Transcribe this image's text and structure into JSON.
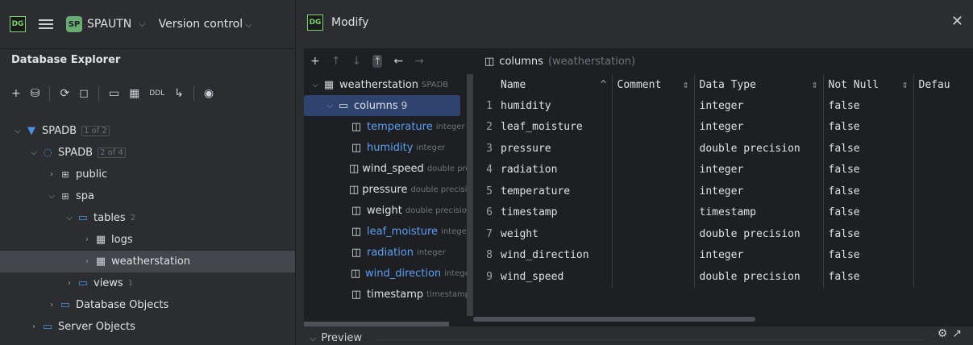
{
  "appbar": {
    "logo": "DG",
    "project_badge": "SP",
    "project_name": "SPAUTN",
    "version_control": "Version control"
  },
  "explorer": {
    "title": "Database Explorer",
    "toolbar": {
      "ddl": "DDL"
    },
    "tree": [
      {
        "label": "SPADB",
        "count": "1 of 2"
      },
      {
        "label": "SPADB",
        "count": "2 of 4"
      },
      {
        "label": "public"
      },
      {
        "label": "spa"
      },
      {
        "label": "tables",
        "count": "2"
      },
      {
        "label": "logs"
      },
      {
        "label": "weatherstation"
      },
      {
        "label": "views",
        "count": "1"
      },
      {
        "label": "Database Objects"
      },
      {
        "label": "Server Objects"
      }
    ]
  },
  "dialog": {
    "title": "Modify",
    "logo": "DG",
    "tree_root": {
      "label": "weatherstation",
      "type": "SPADB"
    },
    "columns_node": {
      "label": "columns",
      "count": "9"
    },
    "column_items": [
      {
        "name": "temperature",
        "type": "integer",
        "link": true
      },
      {
        "name": "humidity",
        "type": "integer",
        "link": true
      },
      {
        "name": "wind_speed",
        "type": "double precision",
        "link": false
      },
      {
        "name": "pressure",
        "type": "double precision",
        "link": false
      },
      {
        "name": "weight",
        "type": "double precision",
        "link": false
      },
      {
        "name": "leaf_moisture",
        "type": "integer",
        "link": true
      },
      {
        "name": "radiation",
        "type": "integer",
        "link": true
      },
      {
        "name": "wind_direction",
        "type": "integer",
        "link": true
      },
      {
        "name": "timestamp",
        "type": "timestamp",
        "link": false
      }
    ],
    "grid_title": "columns",
    "grid_subtitle": "(weatherstation)",
    "headers": [
      "Name",
      "Comment",
      "Data Type",
      "Not Null",
      "Defau"
    ],
    "rows": [
      [
        "1",
        "humidity",
        "",
        "integer",
        "false"
      ],
      [
        "2",
        "leaf_moisture",
        "",
        "integer",
        "false"
      ],
      [
        "3",
        "pressure",
        "",
        "double precision",
        "false"
      ],
      [
        "4",
        "radiation",
        "",
        "integer",
        "false"
      ],
      [
        "5",
        "temperature",
        "",
        "integer",
        "false"
      ],
      [
        "6",
        "timestamp",
        "",
        "timestamp",
        "false"
      ],
      [
        "7",
        "weight",
        "",
        "double precision",
        "false"
      ],
      [
        "8",
        "wind_direction",
        "",
        "integer",
        "false"
      ],
      [
        "9",
        "wind_speed",
        "",
        "double precision",
        "false"
      ]
    ],
    "preview_label": "Preview"
  }
}
